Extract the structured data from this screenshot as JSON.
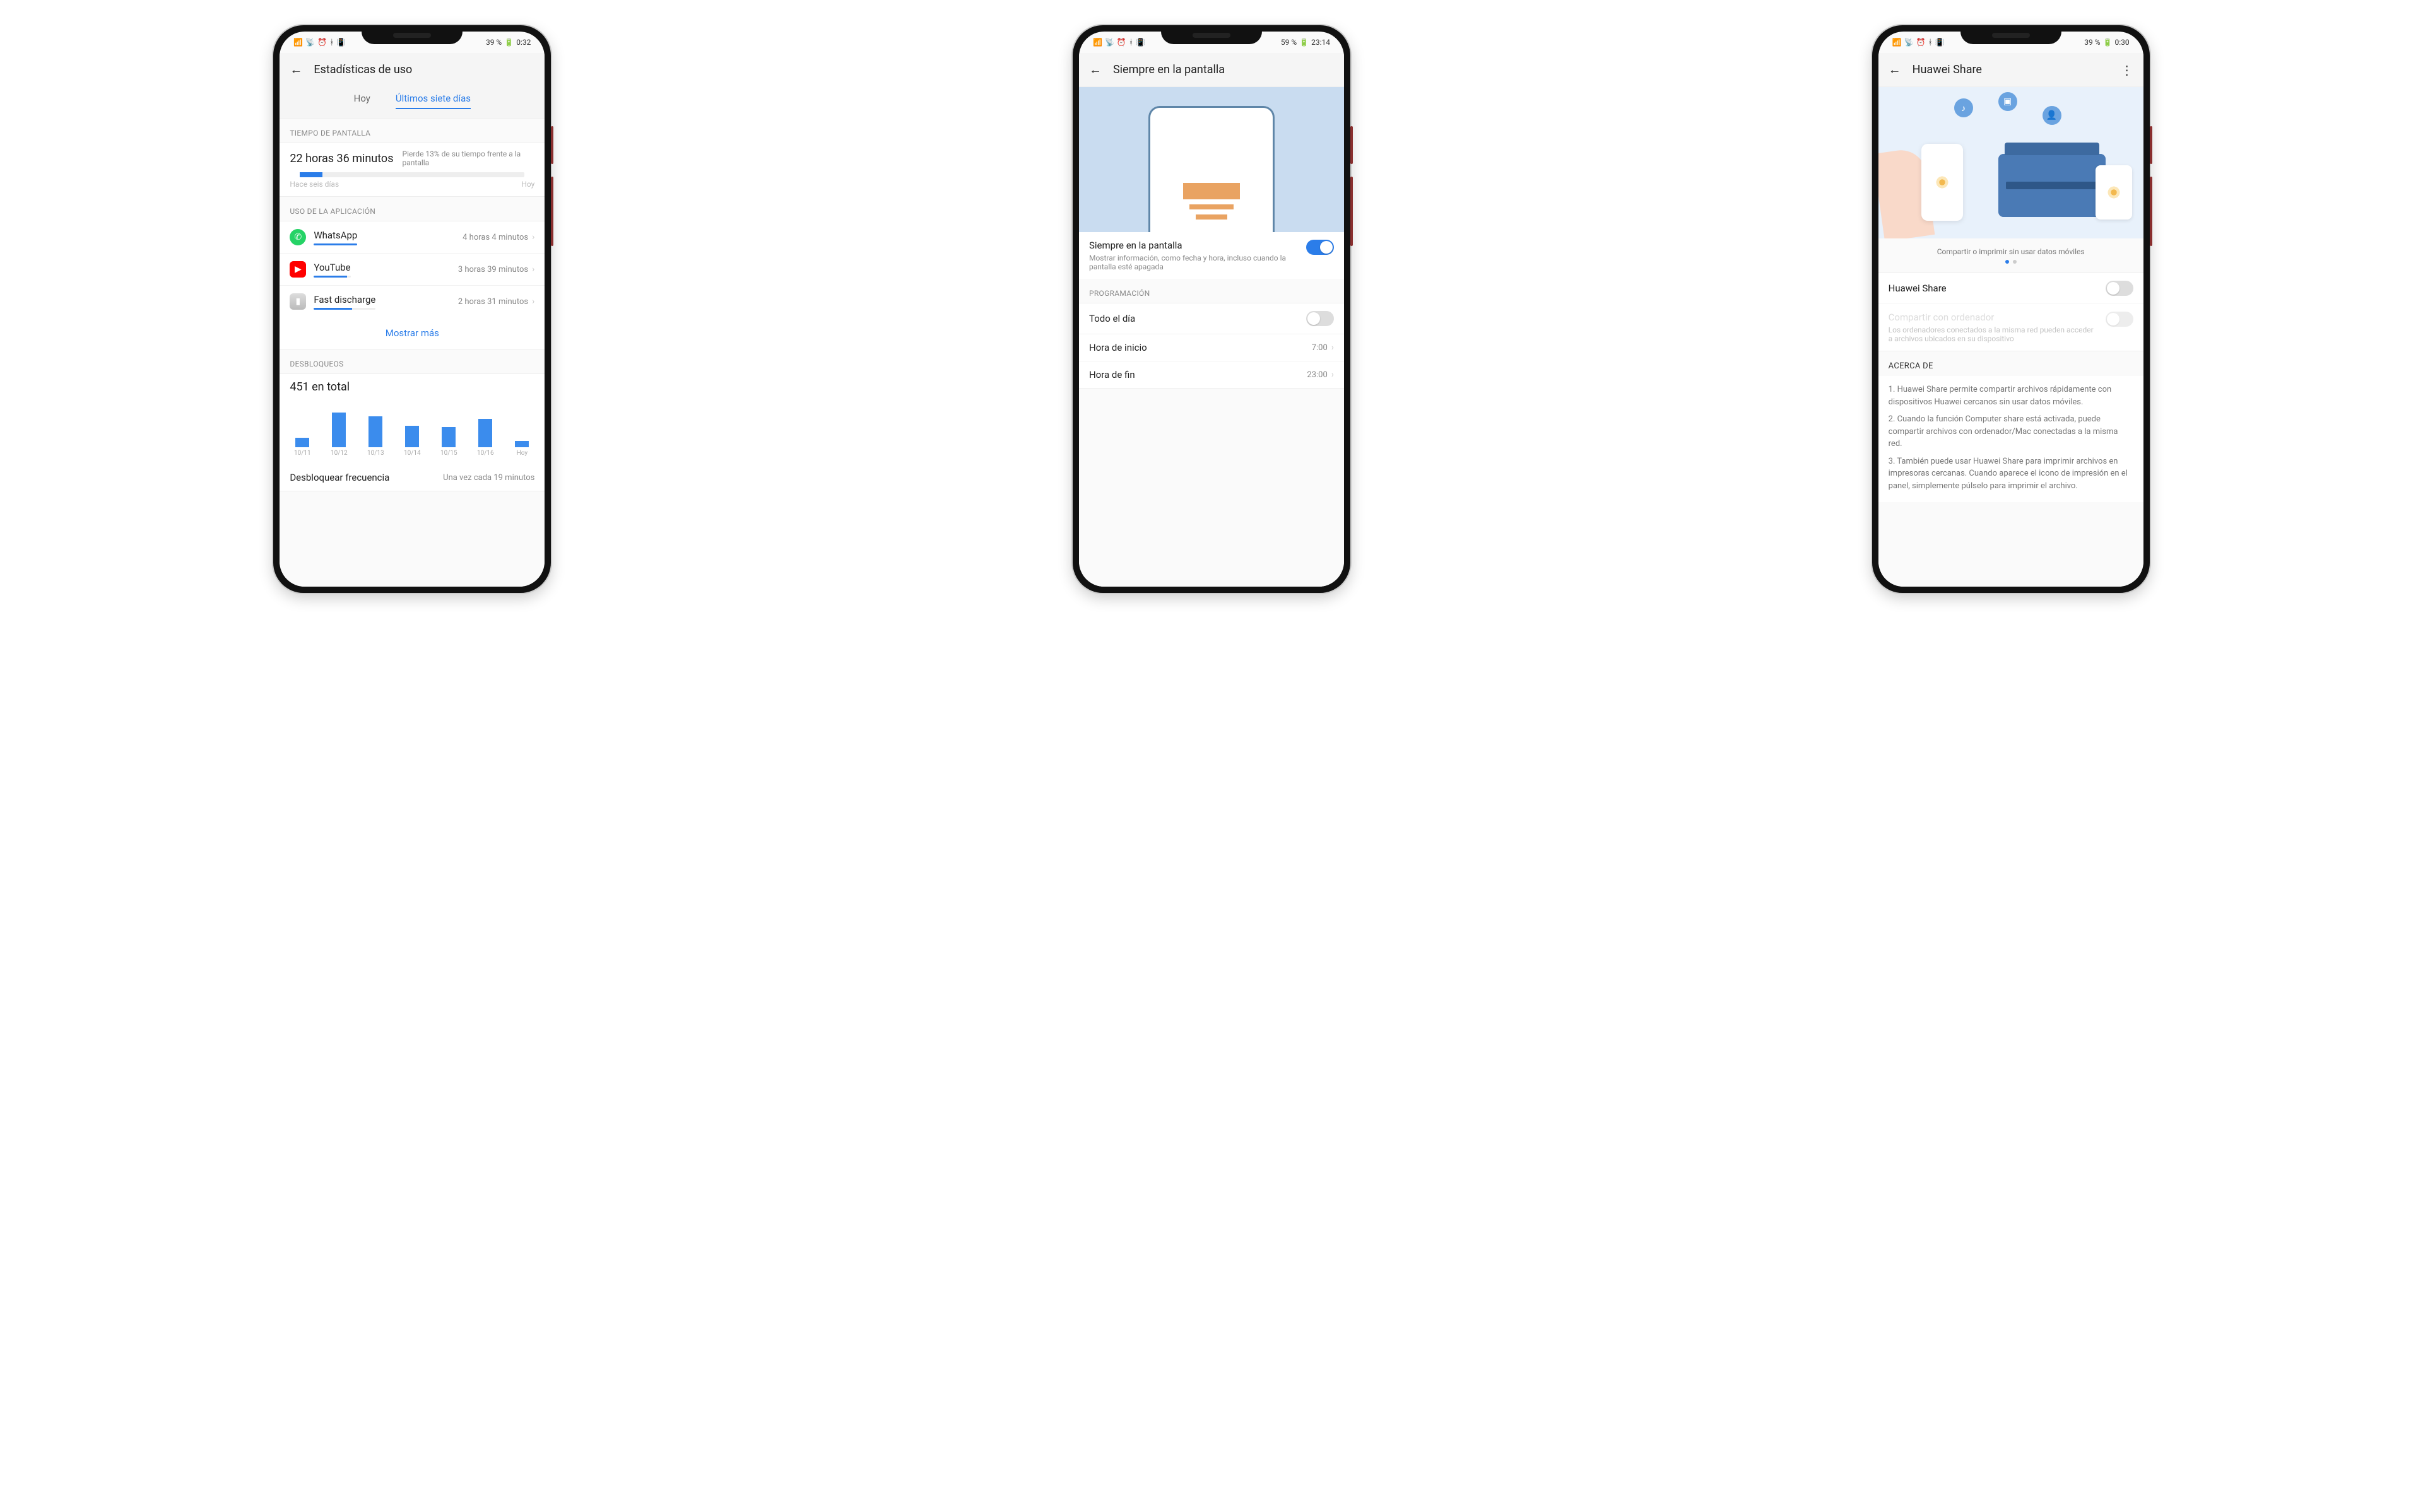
{
  "phones": {
    "usage": {
      "status": {
        "battery": "39 %",
        "time": "0:32"
      },
      "title": "Estadísticas de uso",
      "tabs": {
        "today": "Hoy",
        "week": "Últimos siete días"
      },
      "screenTime": {
        "label": "TIEMPO DE PANTALLA",
        "value": "22 horas 36 minutos",
        "note": "Pierde 13% de su tiempo frente a la pantalla",
        "startLabel": "Hace seis días",
        "endLabel": "Hoy"
      },
      "appUsage": {
        "label": "USO DE LA APLICACIÓN",
        "apps": [
          {
            "name": "WhatsApp",
            "time": "4 horas 4 minutos",
            "pct": 100
          },
          {
            "name": "YouTube",
            "time": "3 horas 39 minutos",
            "pct": 90
          },
          {
            "name": "Fast discharge",
            "time": "2 horas 31 minutos",
            "pct": 62
          }
        ],
        "more": "Mostrar más"
      },
      "unlocks": {
        "label": "DESBLOQUEOS",
        "total": "451 en total",
        "chart_data": {
          "type": "bar",
          "categories": [
            "10/11",
            "10/12",
            "10/13",
            "10/14",
            "10/15",
            "10/16",
            "Hoy"
          ],
          "values": [
            22,
            78,
            70,
            48,
            46,
            64,
            14
          ],
          "ylim": [
            0,
            100
          ]
        },
        "freqLabel": "Desbloquear frecuencia",
        "freqValue": "Una vez cada 19 minutos"
      }
    },
    "aod": {
      "status": {
        "battery": "59 %",
        "time": "23:14"
      },
      "title": "Siempre en la pantalla",
      "toggle": {
        "name": "Siempre en la pantalla",
        "desc": "Mostrar información, como fecha y hora, incluso cuando la pantalla esté apagada"
      },
      "schedule": {
        "label": "PROGRAMACIÓN",
        "allDay": "Todo el día",
        "start": {
          "label": "Hora de inicio",
          "value": "7:00"
        },
        "end": {
          "label": "Hora de fin",
          "value": "23:00"
        }
      }
    },
    "share": {
      "status": {
        "battery": "39 %",
        "time": "0:30"
      },
      "title": "Huawei Share",
      "caption": "Compartir o imprimir sin usar datos móviles",
      "toggles": {
        "main": "Huawei Share",
        "pc": {
          "title": "Compartir con ordenador",
          "desc": "Los ordenadores conectados a la misma red pueden acceder a archivos ubicados en su dispositivo"
        }
      },
      "about": {
        "label": "ACERCA DE",
        "p1": "1. Huawei Share permite compartir archivos rápidamente con dispositivos Huawei cercanos sin usar datos móviles.",
        "p2": "2. Cuando la función Computer share está activada, puede compartir archivos con ordenador/Mac conectadas a la misma red.",
        "p3": "3. También puede usar Huawei Share para imprimir archivos en impresoras cercanas. Cuando aparece el icono de impresión en el panel, simplemente púlselo para imprimir el archivo."
      }
    }
  }
}
